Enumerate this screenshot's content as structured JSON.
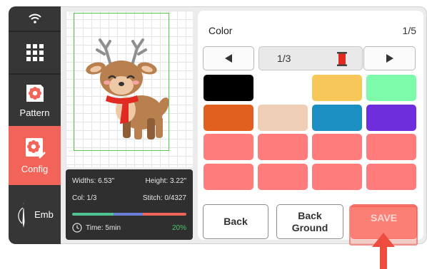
{
  "sidebar": {
    "items": [
      {
        "icon": "wifi-icon",
        "label": ""
      },
      {
        "icon": "grid-icon",
        "label": ""
      },
      {
        "icon": "pattern-icon",
        "label": "Pattern"
      },
      {
        "icon": "config-icon",
        "label": "Config"
      },
      {
        "icon": "needle-icon",
        "label": "Emb"
      }
    ],
    "active": "Config",
    "active_color": "#f2645a"
  },
  "info": {
    "width_label": "Widths: 6.53\"",
    "height_label": "Height: 3.22\"",
    "col_label": "Col: 1/3",
    "stitch_label": "Stitch: 0/4327",
    "time_label": "Time: 5min",
    "percent": "20%",
    "progress_colors": [
      "#4fc38f",
      "#6a7ed6",
      "#f2645a"
    ]
  },
  "panel": {
    "title": "Color",
    "page": "1/5",
    "thread_index": "1/3",
    "thread_color": "#e02a22"
  },
  "swatches": [
    [
      "#000000",
      "#ffffff",
      "#f7c75a",
      "#7dfbaa"
    ],
    [
      "#e15f1f",
      "#eecfb6",
      "#1b8fc2",
      "#6f2edc"
    ],
    [
      "#ff7c7c",
      "#ff7c7c",
      "#ff7c7c",
      "#ff7c7c"
    ],
    [
      "#ff7c7c",
      "#ff7c7c",
      "#ff7c7c",
      "#ff7c7c"
    ]
  ],
  "buttons": {
    "back": "Back",
    "background_line1": "Back",
    "background_line2": "Ground",
    "save": "SAVE"
  }
}
